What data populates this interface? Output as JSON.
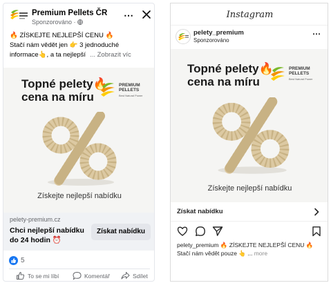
{
  "facebook": {
    "page_name": "Premium Pellets ČR",
    "sponsored": "Sponzorováno · ",
    "more_icon": "⋯",
    "text_line1": "🔥 ZÍSKEJTE NEJLEPŠÍ CENU 🔥",
    "text_line2": "Stačí nám vědět jen 👉 3 jednoduché",
    "text_line3": "informace👆, a ta nejlepší",
    "see_more": "... Zobrazit víc",
    "link_domain": "pelety-premium.cz",
    "link_title": "Chci nejlepší nabídku do 24 hodin ⏰",
    "cta_label": "Získat nabídku",
    "reaction_count": "5",
    "actions": [
      "To se mi líbí",
      "Komentář",
      "Sdílet"
    ]
  },
  "instagram": {
    "brand": "Instagram",
    "username": "pelety_premium",
    "sponsored": "Sponzorováno",
    "more_icon": "⋯",
    "cta_label": "Získat nabídku",
    "caption_user": "pelety_premium",
    "caption_line1": "🔥 ZÍSKEJTE NEJLEPŠÍ CENU 🔥",
    "caption_line2": "Stačí nám vědět pouze 👆 ...",
    "caption_more": "more"
  },
  "creative": {
    "headline_line1": "Topné pelety🔥",
    "headline_line2": "cena na míru",
    "logo_line1": "PREMIUM",
    "logo_line2": "PELLETS",
    "logo_tagline": "Best Natural Power",
    "footer": "Získejte nejlepší nabídku"
  },
  "colors": {
    "facebook_blue": "#1877f2",
    "logo_green": "#7ab929",
    "logo_orange": "#f39200",
    "logo_yellow": "#ffcc00",
    "pellet": "#dcc9a2"
  },
  "icons": {
    "fb_close": "close-icon",
    "fb_like": "thumbs-up-icon",
    "fb_comment": "comment-icon",
    "fb_share": "share-icon",
    "ig_like": "heart-icon",
    "ig_comment": "comment-icon",
    "ig_share": "send-icon",
    "ig_save": "bookmark-icon",
    "ig_cta": "chevron-right-icon"
  }
}
